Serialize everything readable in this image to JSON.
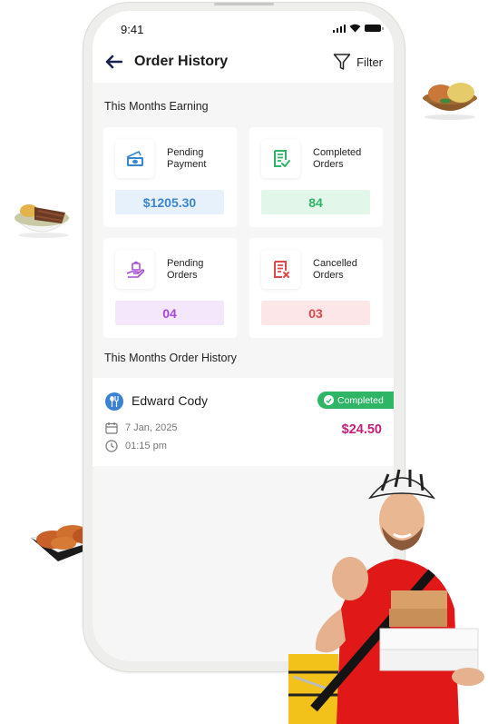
{
  "status_bar": {
    "time": "9:41"
  },
  "header": {
    "title": "Order History",
    "back_icon": "arrow-left-icon",
    "filter_label": "Filter",
    "filter_icon": "funnel-icon"
  },
  "earnings": {
    "section_title": "This Months Earning",
    "cards": [
      {
        "id": "pending-payment",
        "label_line1": "Pending",
        "label_line2": "Payment",
        "value": "$1205.30",
        "icon": "cash-icon",
        "accent": "#3a86cf",
        "bg": "#e6f1fb"
      },
      {
        "id": "completed-orders",
        "label_line1": "Completed",
        "label_line2": "Orders",
        "value": "84",
        "icon": "document-check-icon",
        "accent": "#2fb566",
        "bg": "#e3f6ea"
      },
      {
        "id": "pending-orders",
        "label_line1": "Pending",
        "label_line2": "Orders",
        "value": "04",
        "icon": "hand-bag-icon",
        "accent": "#a64ad6",
        "bg": "#f4e6fb"
      },
      {
        "id": "cancelled-orders",
        "label_line1": "Cancelled",
        "label_line2": "Orders",
        "value": "03",
        "icon": "document-x-icon",
        "accent": "#e0474c",
        "bg": "#fde6e7"
      }
    ]
  },
  "order_history": {
    "section_title": "This Months Order History",
    "orders": [
      {
        "customer": "Edward Cody",
        "status": "Completed",
        "date": "7 Jan, 2025",
        "time": "01:15 pm",
        "amount": "$24.50",
        "avatar_icon": "utensils-icon"
      }
    ]
  },
  "colors": {
    "completed_badge": "#2fb566",
    "amount": "#c41f7b",
    "navy": "#1a2350"
  }
}
